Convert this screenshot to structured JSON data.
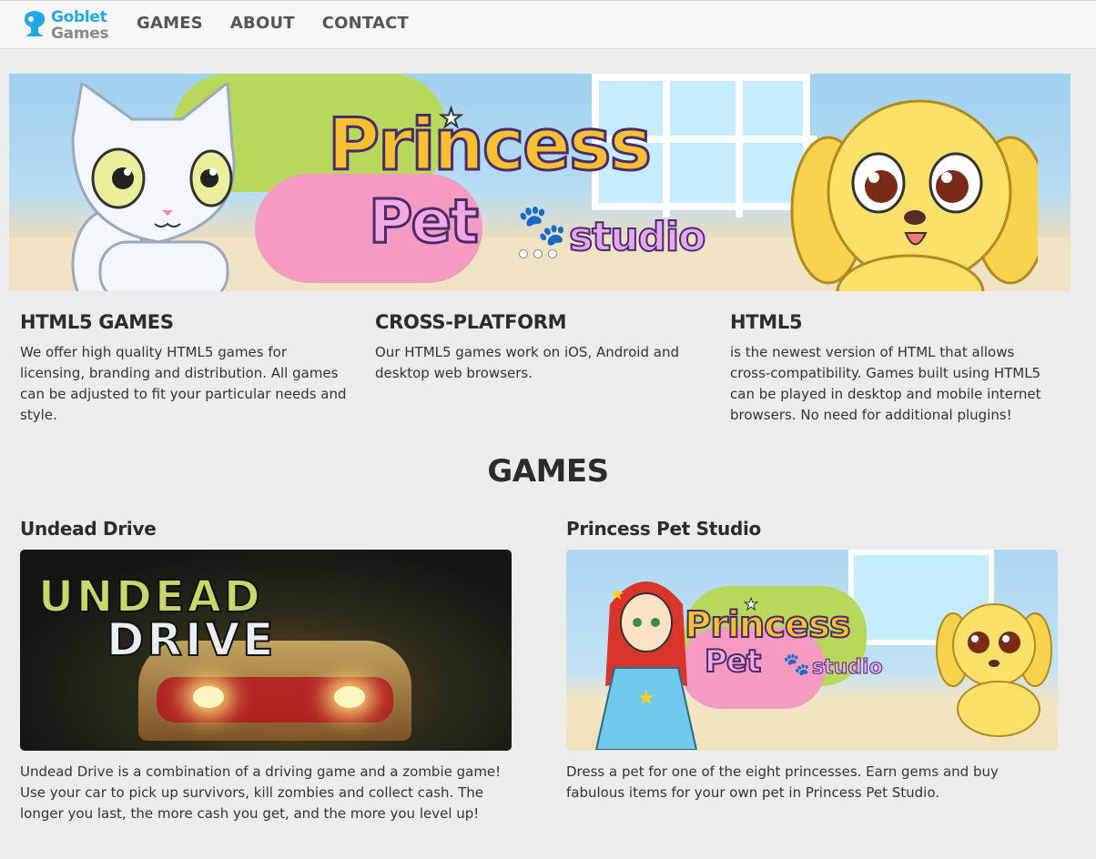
{
  "brand": {
    "line1": "Goblet",
    "line2": "Games",
    "accent": "#23a8e6"
  },
  "nav": {
    "items": [
      {
        "label": "GAMES"
      },
      {
        "label": "ABOUT"
      },
      {
        "label": "CONTACT"
      }
    ]
  },
  "hero": {
    "title": "Princess",
    "subtitle1": "Pet",
    "subtitle2": "studio",
    "slides": 3,
    "star_icon": "star-icon",
    "paw_icon": "paw-icon"
  },
  "features": [
    {
      "title": "HTML5 GAMES",
      "text": "We offer high quality HTML5 games for licensing, branding and distribution. All games can be adjusted to fit your particular needs and style."
    },
    {
      "title": "CROSS-PLATFORM",
      "text": "Our HTML5 games work on iOS, Android and desktop web browsers."
    },
    {
      "title": "HTML5",
      "text": "is the newest version of HTML that allows cross-compatibility. Games built using HTML5 can be played in desktop and mobile internet browsers. No need for additional plugins!"
    }
  ],
  "games_heading": "GAMES",
  "games": [
    {
      "title": "Undead Drive",
      "thumb_line1": "UNDEAD",
      "thumb_line2": "DRIVE",
      "description": "Undead Drive is a combination of a driving game and a zombie game! Use your car to pick up survivors, kill zombies and collect cash. The longer you last, the more cash you get, and the more you level up!"
    },
    {
      "title": "Princess Pet Studio",
      "thumb_line1": "Princess",
      "thumb_line2": "Pet",
      "thumb_line3": "studio",
      "description": "Dress a pet for one of the eight princesses. Earn gems and buy fabulous items for your own pet in Princess Pet Studio."
    }
  ]
}
